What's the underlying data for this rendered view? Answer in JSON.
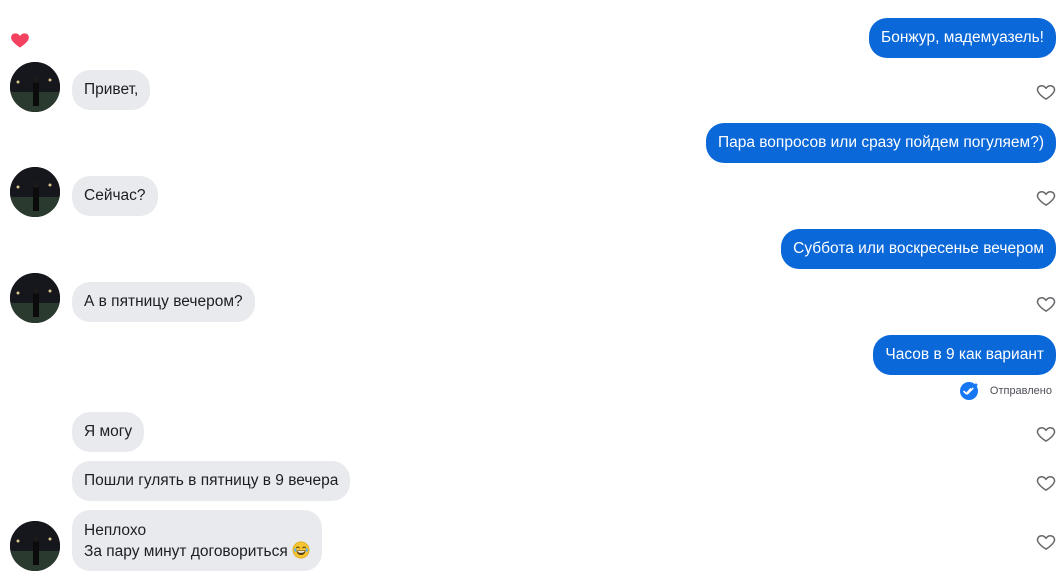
{
  "messages": {
    "out_1": "Бонжур, мадемуазель!",
    "in_1": "Привет,",
    "out_2": "Пара вопросов или сразу пойдем погуляем?)",
    "in_2": "Сейчас?",
    "out_3": "Суббота или воскресенье вечером",
    "in_3": "А в пятницу вечером?",
    "out_4": "Часов в 9 как вариант",
    "in_4": "Я могу",
    "in_5": "Пошли гулять в пятницу в 9 вечера",
    "in_6_line1": "Неплохо",
    "in_6_line2": "За пару минут договориться"
  },
  "status": {
    "sent_label": "Отправлено"
  },
  "icons": {
    "reaction": "heart-icon",
    "like": "heart-outline-icon",
    "sent": "double-check-icon",
    "emoji": "laughing-tears-emoji"
  },
  "colors": {
    "outgoing_bubble": "#0a68d8",
    "incoming_bubble": "#e9eaee",
    "reaction_heart": "#f3425f"
  }
}
